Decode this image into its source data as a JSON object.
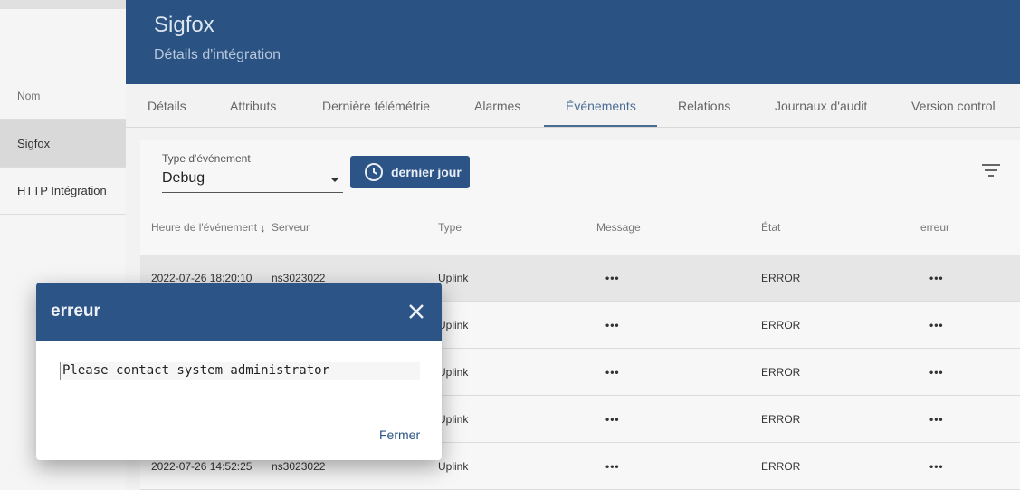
{
  "left_list": {
    "header": "Nom",
    "rows": [
      "Sigfox",
      "HTTP Intégration"
    ]
  },
  "details": {
    "title": "Sigfox",
    "subtitle": "Détails d'intégration",
    "tabs": [
      "Détails",
      "Attributs",
      "Dernière télémétrie",
      "Alarmes",
      "Événements",
      "Relations",
      "Journaux d'audit",
      "Version control"
    ],
    "active_tab": "Événements"
  },
  "events": {
    "type_label": "Type d'événement",
    "type_value": "Debug",
    "time_button": "dernier jour",
    "columns": [
      "Heure de l'événement",
      "Serveur",
      "Type",
      "Message",
      "État",
      "erreur"
    ],
    "rows": [
      {
        "time": "2022-07-26 18:20:10",
        "server": "ns3023022",
        "type": "Uplink",
        "message": "•••",
        "state": "ERROR",
        "error": "•••"
      },
      {
        "time": "",
        "server": "",
        "type": "Uplink",
        "message": "•••",
        "state": "ERROR",
        "error": "•••"
      },
      {
        "time": "",
        "server": "",
        "type": "Uplink",
        "message": "•••",
        "state": "ERROR",
        "error": "•••"
      },
      {
        "time": "",
        "server": "",
        "type": "Uplink",
        "message": "•••",
        "state": "ERROR",
        "error": "•••"
      },
      {
        "time": "2022-07-26 14:52:25",
        "server": "ns3023022",
        "type": "Uplink",
        "message": "•••",
        "state": "ERROR",
        "error": "•••"
      }
    ]
  },
  "dialog": {
    "title": "erreur",
    "body": "Please contact system administrator",
    "close_button": "Fermer"
  },
  "colors": {
    "primary": "#2d5486",
    "header": "#2a5282",
    "accent_tab": "#4a6d96"
  }
}
